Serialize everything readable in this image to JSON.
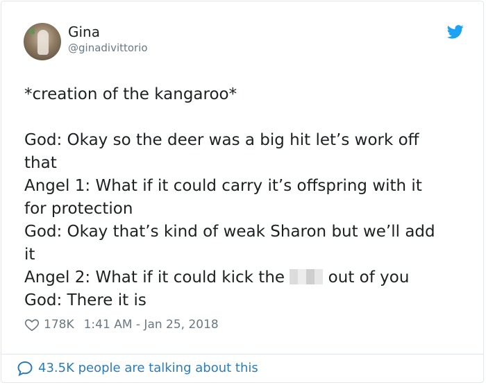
{
  "author": {
    "name": "Gina",
    "handle": "@ginadivittorio"
  },
  "tweet": {
    "lines": [
      "*creation of the kangaroo*",
      "God: Okay so the deer was a big hit let’s work off",
      "that",
      "Angel 1: What if it could carry it’s offspring with it",
      "for protection",
      "God: Okay that’s kind of weak Sharon but we’ll add",
      "it",
      "Angel 2: What if it could kick the",
      "out of you",
      "God: There it is"
    ]
  },
  "meta": {
    "likes": "178K",
    "timestamp": "1:41 AM - Jan 25, 2018"
  },
  "footer": {
    "talking": "43.5K people are talking about this"
  },
  "colors": {
    "twitter_blue": "#1da1f2",
    "link_blue": "#2b7bb9",
    "muted_gray": "#697882"
  },
  "icons": {
    "brand": "twitter-bird-icon",
    "like": "heart-icon",
    "reply": "speech-bubble-icon"
  }
}
